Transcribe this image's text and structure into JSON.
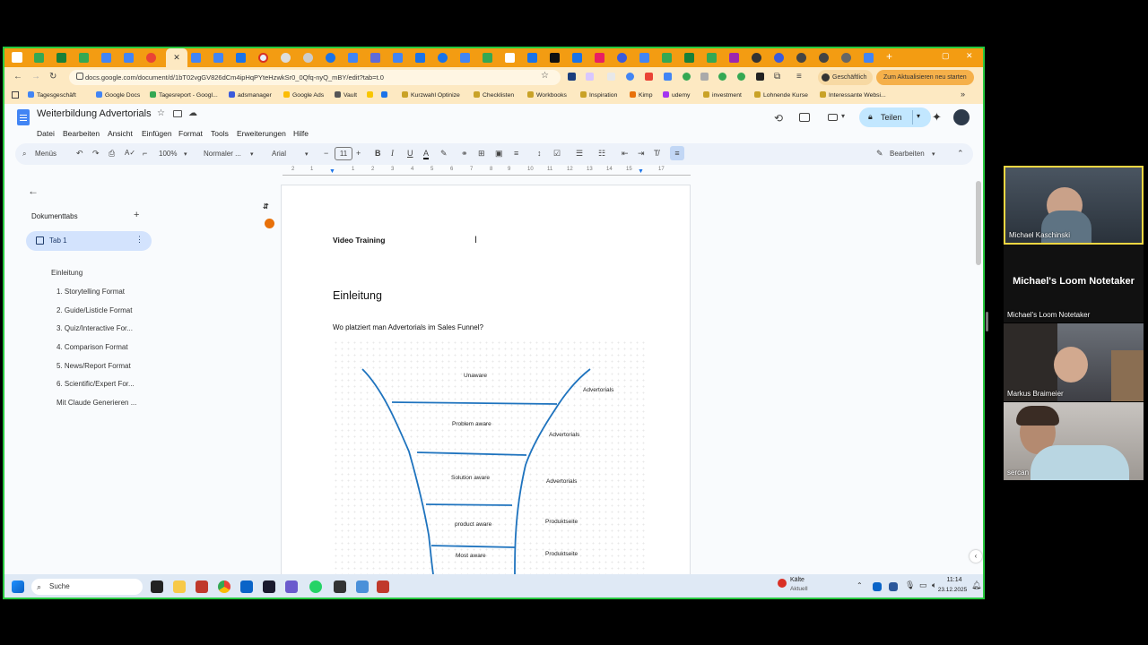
{
  "browser": {
    "url": "docs.google.com/document/d/1bT02vgGV826dCm4ipHqPYteHzwkSr0_0Qfq-nyQ_mBY/edit?tab=t.0",
    "profile_label": "Geschäftlich",
    "update_label": "Zum Aktualisieren neu starten",
    "bookmarks": [
      "Tagesgeschäft",
      "Google Docs",
      "Tagesreport - Googl...",
      "adsmanager",
      "Google Ads",
      "Vault",
      "Kurzwahl Optinize",
      "Checklisten",
      "Workbooks",
      "Inspiration",
      "Kimp",
      "udemy",
      "investment",
      "Lohnende Kurse",
      "Interessante Websi..."
    ]
  },
  "docs": {
    "title": "Weiterbildung Advertorials",
    "menus": [
      "Datei",
      "Bearbeiten",
      "Ansicht",
      "Einfügen",
      "Format",
      "Tools",
      "Erweiterungen",
      "Hilfe"
    ],
    "share_label": "Teilen",
    "toolbar": {
      "search_label": "Menüs",
      "zoom": "100%",
      "style": "Normaler ...",
      "font": "Arial",
      "font_size": "11",
      "mode_label": "Bearbeiten"
    },
    "ruler_ticks": [
      "2",
      "1",
      "1",
      "2",
      "3",
      "4",
      "5",
      "6",
      "7",
      "8",
      "9",
      "10",
      "11",
      "12",
      "13",
      "14",
      "15",
      "16",
      "17",
      "18"
    ],
    "sidebar": {
      "heading": "Dokumenttabs",
      "tab_label": "Tab 1",
      "outline": [
        "Einleitung",
        "1. Storytelling Format",
        "2. Guide/Listicle Format",
        "3. Quiz/Interactive For...",
        "4. Comparison Format",
        "5. News/Report Format",
        "6. Scientific/Expert For...",
        "Mit Claude Generieren ..."
      ]
    },
    "page": {
      "title": "Video Training",
      "heading": "Einleitung",
      "question": "Wo platziert man Advertorials im Sales Funnel?",
      "funnel_stages": [
        "Unaware",
        "Problem aware",
        "Solution aware",
        "product aware",
        "Most aware"
      ],
      "funnel_targets": [
        "Advertorials",
        "Advertorials",
        "Advertorials",
        "Produktseite",
        "Produktseite"
      ]
    }
  },
  "taskbar": {
    "search_label": "Suche",
    "weather_label": "Kälte",
    "weather_sub": "Aktuell",
    "time": "11:14",
    "date": "23.12.2025"
  },
  "participants": [
    {
      "name": "Michael Kaschinski"
    },
    {
      "name": "Michael's Loom Notetaker",
      "big_label": "Michael's Loom Notetaker"
    },
    {
      "name": "Markus Braimeier"
    },
    {
      "name": "sercan"
    }
  ]
}
